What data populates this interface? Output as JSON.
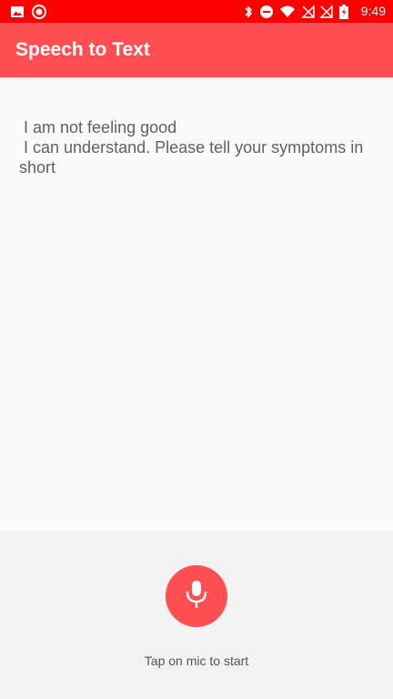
{
  "status_bar": {
    "time": "9:49",
    "left_icons": [
      "image-icon",
      "record-icon"
    ],
    "right_icons": [
      "bluetooth-icon",
      "do-not-disturb-icon",
      "wifi-icon",
      "no-sim-icon",
      "no-sim-icon",
      "battery-charging-icon"
    ]
  },
  "app_bar": {
    "title": "Speech to Text"
  },
  "transcript": {
    "text": " I am not feeling good\n I can understand. Please tell your symptoms in short"
  },
  "mic": {
    "icon": "microphone-icon",
    "hint": "Tap on mic to start"
  },
  "colors": {
    "status_bar": "#ff0000",
    "app_bar": "#ff4f52",
    "mic_button": "#ff4f52",
    "transcript_text": "#616161"
  }
}
